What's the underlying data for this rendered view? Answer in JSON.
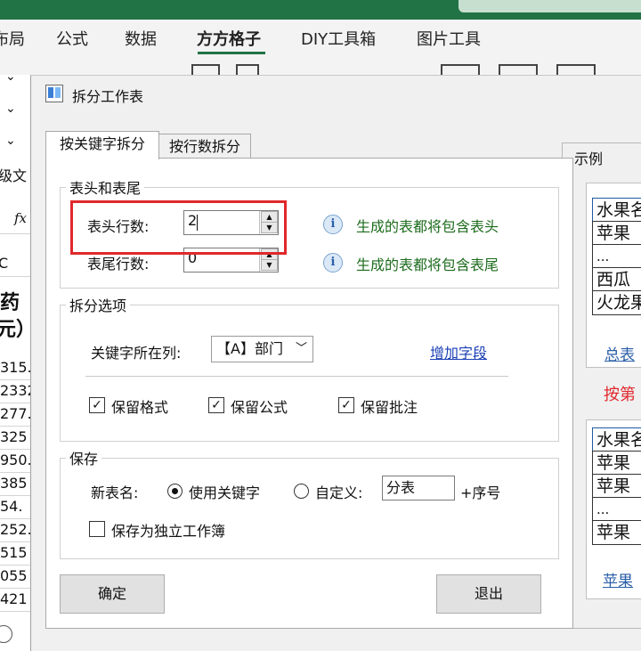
{
  "excel": {
    "ribbon_tabs": [
      "布局",
      "公式",
      "数据",
      "方方格子",
      "DIY工具箱",
      "图片工具"
    ],
    "active_tab": "方方格子",
    "formula_fx": "fx",
    "sheet_column_letter": "C",
    "sheet_partial_header": [
      "药",
      "元）"
    ],
    "sheet_partial_values": [
      "315.",
      "2332",
      "277.",
      "325",
      "950.",
      "385",
      "54.",
      "252.",
      "515",
      "055",
      "421"
    ],
    "ribbon_side_label": "级文"
  },
  "dialog": {
    "title": "拆分工作表",
    "tabs": [
      {
        "label": "按关键字拆分",
        "selected": true
      },
      {
        "label": "按行数拆分",
        "selected": false
      }
    ],
    "header_footer": {
      "group_label": "表头和表尾",
      "header_rows_label": "表头行数:",
      "header_rows_value": "2",
      "footer_rows_label": "表尾行数:",
      "footer_rows_value": "0",
      "header_note": "生成的表都将包含表头",
      "footer_note": "生成的表都将包含表尾",
      "info_glyph": "i"
    },
    "split_options": {
      "group_label": "拆分选项",
      "key_column_label": "关键字所在列:",
      "key_column_value": "【A】部门",
      "add_field_link": "增加字段",
      "checkboxes": [
        {
          "label": "保留格式",
          "checked": true
        },
        {
          "label": "保留公式",
          "checked": true
        },
        {
          "label": "保留批注",
          "checked": true
        }
      ]
    },
    "save": {
      "group_label": "保存",
      "new_name_label": "新表名:",
      "radio_keyword": {
        "label": "使用关键字",
        "selected": true
      },
      "radio_custom": {
        "label": "自定义:",
        "selected": false
      },
      "custom_value": "分表",
      "suffix_label": "+序号",
      "standalone_workbook": {
        "label": "保存为独立工作簿",
        "checked": false
      }
    },
    "buttons": {
      "ok": "确定",
      "exit": "退出"
    },
    "example": {
      "label": "示例",
      "card1_rows": [
        "水果名",
        "苹果",
        "...",
        "西瓜",
        "火龙果"
      ],
      "card1_footer": "总表",
      "split_caption": "按第",
      "card2_rows": [
        "水果名",
        "苹果",
        "苹果",
        "...",
        "苹果"
      ],
      "card2_footer": "苹果"
    }
  },
  "colors": {
    "excel_green": "#217346",
    "highlight_red": "#e0282c",
    "note_green": "#1c6b1c",
    "link_blue": "#1a3fb5"
  }
}
